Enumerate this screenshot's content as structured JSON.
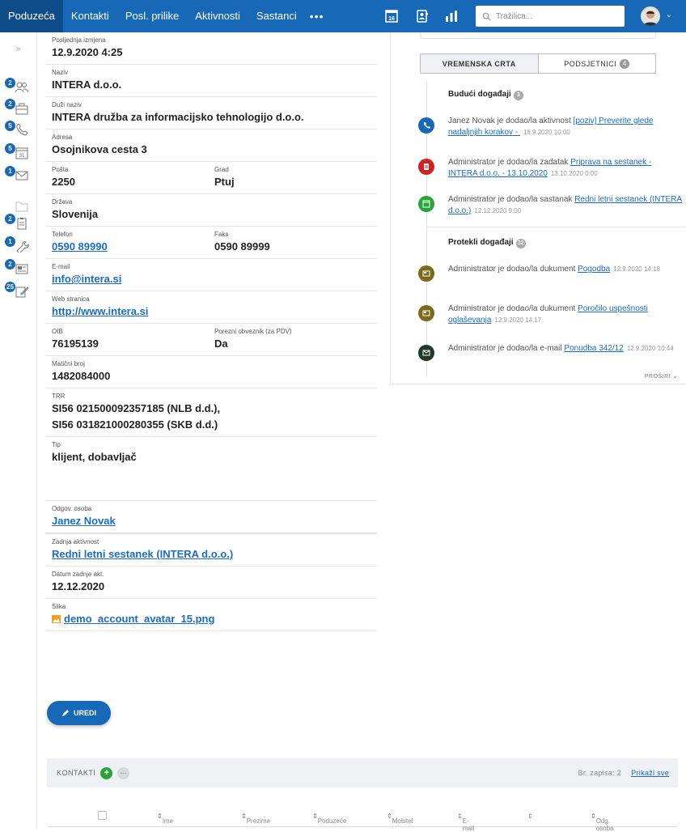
{
  "topbar": {
    "nav": [
      "Poduzeća",
      "Kontakti",
      "Posl. prilike",
      "Aktivnosti",
      "Sastanci"
    ],
    "more": "•••",
    "calendar_day": "16",
    "search_placeholder": "Tražilica...",
    "accent": "#1769b7"
  },
  "sidebar": {
    "items": [
      {
        "icon": "contacts-icon",
        "badge": "2"
      },
      {
        "icon": "briefcase-icon",
        "badge": "2"
      },
      {
        "icon": "phone-icon",
        "badge": "5"
      },
      {
        "icon": "calendar-icon",
        "badge": "5",
        "day": "31"
      },
      {
        "icon": "mail-icon",
        "badge": "1"
      },
      {
        "icon": "folder-icon",
        "badge": ""
      },
      {
        "icon": "clipboard-icon",
        "badge": "2"
      },
      {
        "icon": "wrench-icon",
        "badge": "1"
      },
      {
        "icon": "news-icon",
        "badge": "2"
      },
      {
        "icon": "note-icon",
        "badge": "25"
      }
    ]
  },
  "details": {
    "last_modified": {
      "label": "Posljednja izmjena",
      "value": "12.9.2020 4:25"
    },
    "name": {
      "label": "Naziv",
      "value": "INTERA d.o.o."
    },
    "long_name": {
      "label": "Duži naziv",
      "value": "INTERA družba za informacijsko tehnologijo d.o.o."
    },
    "address": {
      "label": "Adresa",
      "value": "Osojnikova cesta 3"
    },
    "post": {
      "label": "Pošta",
      "value": "2250"
    },
    "city": {
      "label": "Grad",
      "value": "Ptuj"
    },
    "country": {
      "label": "Država",
      "value": "Slovenija"
    },
    "phone": {
      "label": "Telefon",
      "value": "0590 89990"
    },
    "fax": {
      "label": "Faks",
      "value": "0590 89999"
    },
    "email": {
      "label": "E-mail",
      "value": "info@intera.si"
    },
    "web": {
      "label": "Web stranica",
      "value": "http://www.intera.si"
    },
    "oib": {
      "label": "OIB",
      "value": "76195139"
    },
    "vat": {
      "label": "Porezni obveznik (za PDV)",
      "value": "Da"
    },
    "reg_no": {
      "label": "Matični broj",
      "value": "1482084000"
    },
    "trr": {
      "label": "TRR",
      "value1": "SI56 021500092357185 (NLB d.d.),",
      "value2": "SI56 031821000280355 (SKB d.d.)"
    },
    "type": {
      "label": "Tip",
      "value": "klijent, dobavljač"
    },
    "owner": {
      "label": "Odgov. osoba",
      "value": "Janez Novak"
    },
    "last_activity": {
      "label": "Zadnja aktivnost",
      "value": "Redni letni sestanek (INTERA d.o.o.)"
    },
    "last_activity_date": {
      "label": "Datum zadnje akt.",
      "value": "12.12.2020"
    },
    "image": {
      "label": "Slika",
      "value": "demo_account_avatar_15.png"
    }
  },
  "edit_button": "UREDI",
  "timeline": {
    "tabs": [
      {
        "label": "VREMENSKA CRTA"
      },
      {
        "label": "PODSJETNICI",
        "count": "4"
      }
    ],
    "future": {
      "title": "Budući događaji",
      "count": "3"
    },
    "past": {
      "title": "Protekli događaji",
      "count": "32"
    },
    "events": [
      {
        "icon": "phone-icon",
        "color": "#1769b7",
        "pre": "Janez Novak je dodao/la aktivnost ",
        "link": "[poziv] Preverite glede nadaljnjih korakov - ",
        "date": "18.9.2020 10:00"
      },
      {
        "icon": "clipboard-icon",
        "color": "#d0231f",
        "pre": "Administrator je dodao/la zadatak ",
        "link": "Priprava na sestanek - INTERA d.o.o. - 13.10.2020",
        "date": "13.10.2020 0:00"
      },
      {
        "icon": "calendar-icon",
        "color": "#2aa33a",
        "pre": "Administrator je dodao/la sastanak ",
        "link": "Redni letni sestanek (INTERA d.o.o.)",
        "date": "12.12.2020 9:00"
      },
      {
        "icon": "document-icon",
        "color": "#7a6a1e",
        "pre": "Administrator je dodao/la dukument ",
        "link": "Pogodba",
        "date": "12.9.2020 14:18"
      },
      {
        "icon": "document-icon",
        "color": "#7a6a1e",
        "pre": "Administrator je dodao/la dukument ",
        "link": "Poročilo uspešnosti oglaševanja",
        "date": "12.9.2020 14:17"
      },
      {
        "icon": "mail-icon",
        "color": "#1f3a2a",
        "pre": "Administrator je dodao/la e-mail ",
        "link": "Ponudba 342/12",
        "date": "12.9.2020 10:44"
      }
    ],
    "expand": "PROŠIRI"
  },
  "contacts": {
    "title": "KONTAKTI",
    "record_count": "Br. zapisa: 2",
    "show_all": "Prikaži sve",
    "columns": [
      "Ime",
      "Prezime",
      "Poduzeće",
      "Mobitel",
      "E-mail",
      "",
      "Odg. osoba"
    ]
  }
}
